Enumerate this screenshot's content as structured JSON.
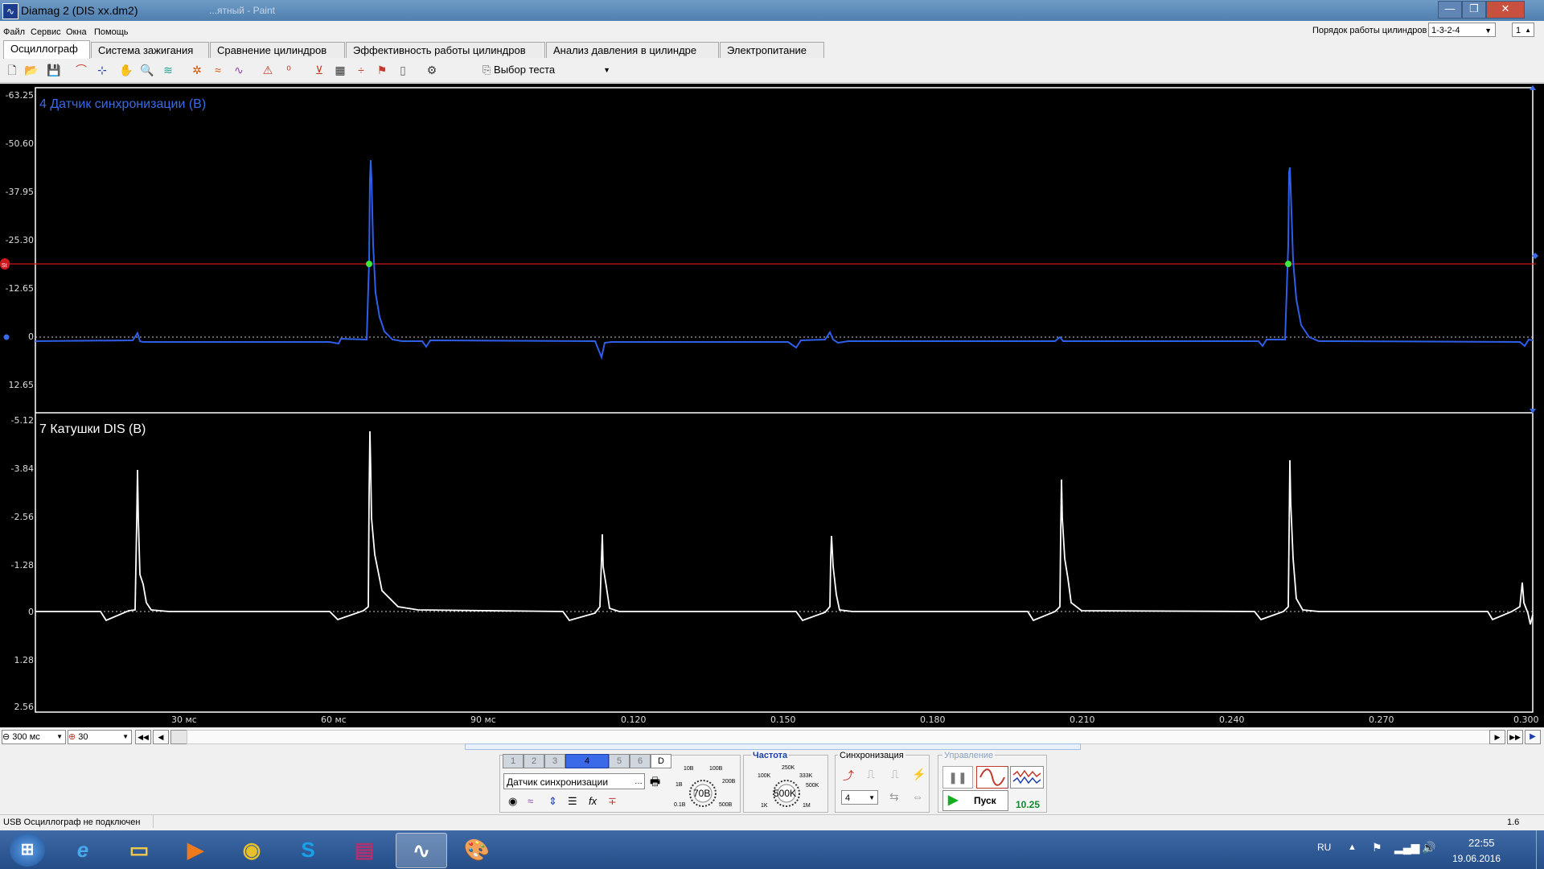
{
  "window": {
    "title": "Diamag 2 (DIS xx.dm2)",
    "ghost_title": "...ятный - Paint",
    "minimize": "—",
    "maximize": "❐",
    "close": "✕"
  },
  "menu": [
    "Файл",
    "Сервис",
    "Окна",
    "Помощь"
  ],
  "cylinder_order": {
    "label": "Порядок работы цилиндров",
    "value": "1-3-2-4",
    "index": "1"
  },
  "tabs": [
    "Осциллограф",
    "Система зажигания",
    "Сравнение цилиндров",
    "Эффективность работы цилиндров",
    "Анализ давления в цилиндре",
    "Электропитание"
  ],
  "toolbar": {
    "test_select": "Выбор теста"
  },
  "channels": [
    {
      "title": "4 Датчик синхронизации (В)",
      "color": "#2f5ee8",
      "y_ticks": [
        "-63.25",
        "-50.60",
        "-37.95",
        "-25.30",
        "-12.65",
        "0",
        "12.65"
      ]
    },
    {
      "title": "7 Катушки DIS (В)",
      "color": "#ffffff",
      "y_ticks": [
        "-5.12",
        "-3.84",
        "-2.56",
        "-1.28",
        "0",
        "1.28",
        "2.56"
      ]
    }
  ],
  "x_ticks": [
    "30 мс",
    "60 мс",
    "90 мс",
    "0.120",
    "0.150",
    "0.180",
    "0.210",
    "0.240",
    "0.270",
    "0.300"
  ],
  "trigger_level_marker": "St",
  "scroll": {
    "timebase": "300 мс",
    "zoom": "30"
  },
  "controls": {
    "channel_buttons": [
      "1",
      "2",
      "3",
      "4",
      "5",
      "6",
      "D"
    ],
    "active_channel": "4",
    "channel_source": "Датчик синхронизации",
    "voltage_dial": {
      "value": "70В",
      "marks": [
        "10В",
        "100В",
        "1В",
        "200В",
        "0.1В",
        "500В"
      ]
    },
    "freq_label": "Частота",
    "freq_dial": {
      "value": "500K",
      "marks": [
        "250K",
        "100K",
        "333K",
        "500K",
        "1K",
        "1M"
      ]
    },
    "sync_label": "Синхронизация",
    "sync_channel": "4",
    "control_label": "Управление",
    "start_button": "Пуск",
    "fps": "10.25"
  },
  "status": {
    "text": "USB Осциллограф не подключен",
    "right": "1.6"
  },
  "taskbar": {
    "lang": "RU",
    "time": "22:55",
    "date": "19.06.2016"
  }
}
